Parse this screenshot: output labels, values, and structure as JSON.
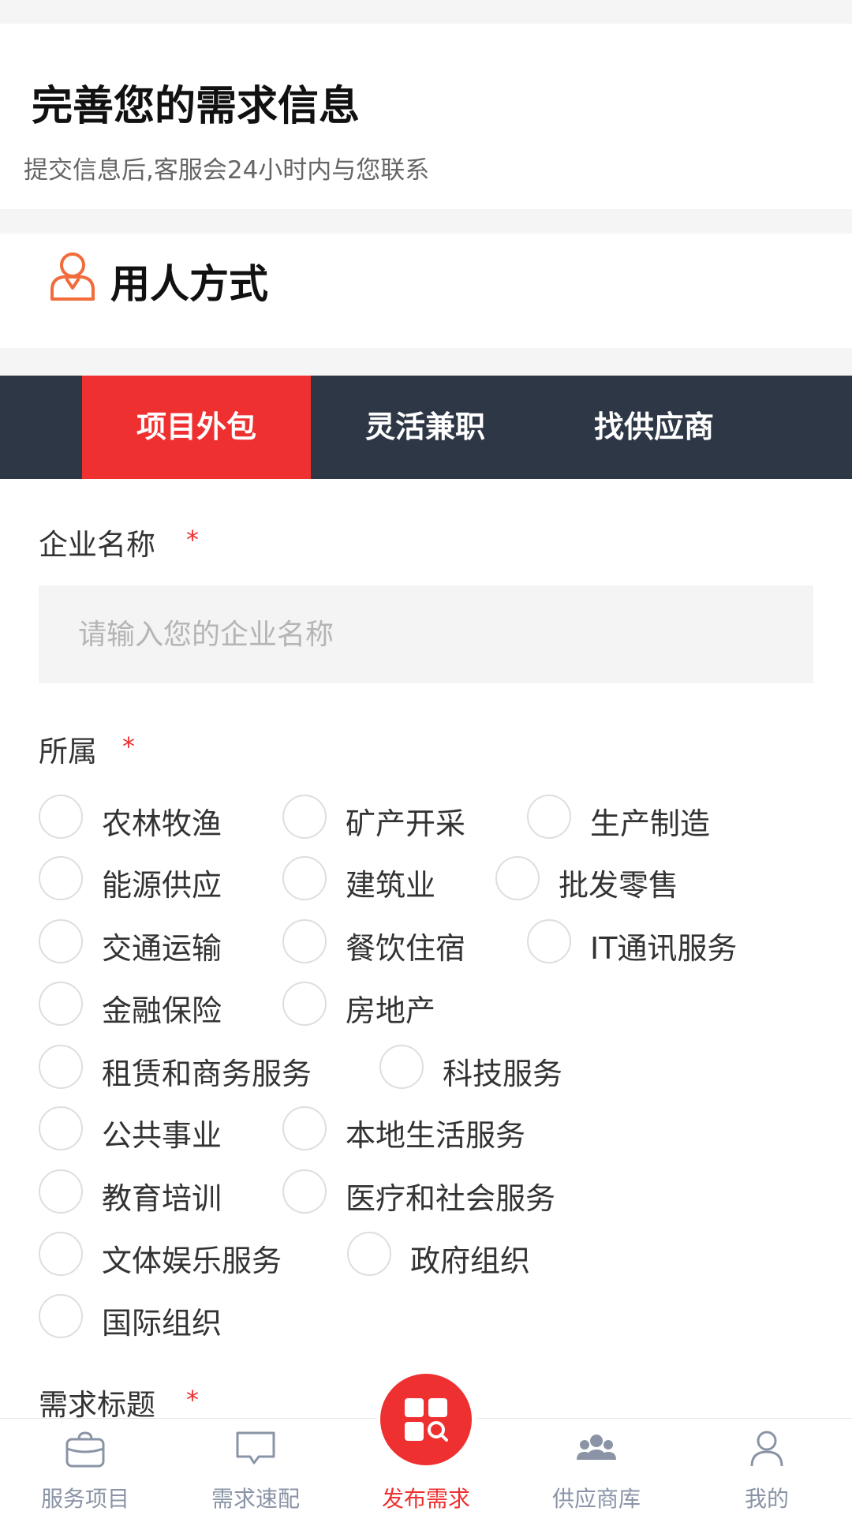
{
  "intro": {
    "title": "完善您的需求信息",
    "subtitle": "提交信息后,客服会24小时内与您联系"
  },
  "section": {
    "title": "用人方式",
    "icon": "person-icon"
  },
  "tabs": [
    {
      "label": "项目外包",
      "active": true
    },
    {
      "label": "灵活兼职",
      "active": false
    },
    {
      "label": "找供应商",
      "active": false
    }
  ],
  "form": {
    "company": {
      "label": "企业名称",
      "required_mark": "*",
      "placeholder": "请输入您的企业名称",
      "value": ""
    },
    "industry": {
      "label": "所属",
      "required_mark": "*",
      "options": [
        "农林牧渔",
        "矿产开采",
        "生产制造",
        "能源供应",
        "建筑业",
        "批发零售",
        "交通运输",
        "餐饮住宿",
        "IT通讯服务",
        "金融保险",
        "房地产",
        "租赁和商务服务",
        "科技服务",
        "公共事业",
        "本地生活服务",
        "教育培训",
        "医疗和社会服务",
        "文体娱乐服务",
        "政府组织",
        "国际组织"
      ]
    },
    "demand_title": {
      "label": "需求标题",
      "required_mark": "*"
    }
  },
  "bottom_nav": [
    {
      "label": "服务项目",
      "icon": "briefcase-icon",
      "active": false
    },
    {
      "label": "需求速配",
      "icon": "chat-bubble-icon",
      "active": false
    },
    {
      "label": "发布需求",
      "icon": "publish-grid-icon",
      "active": true
    },
    {
      "label": "供应商库",
      "icon": "group-icon",
      "active": false
    },
    {
      "label": "我的",
      "icon": "user-icon",
      "active": false
    }
  ],
  "colors": {
    "accent": "#ef3030",
    "tabbar_bg": "#2e3746",
    "icon_orange": "#f26b3a",
    "nav_gray": "#8a94a6"
  }
}
